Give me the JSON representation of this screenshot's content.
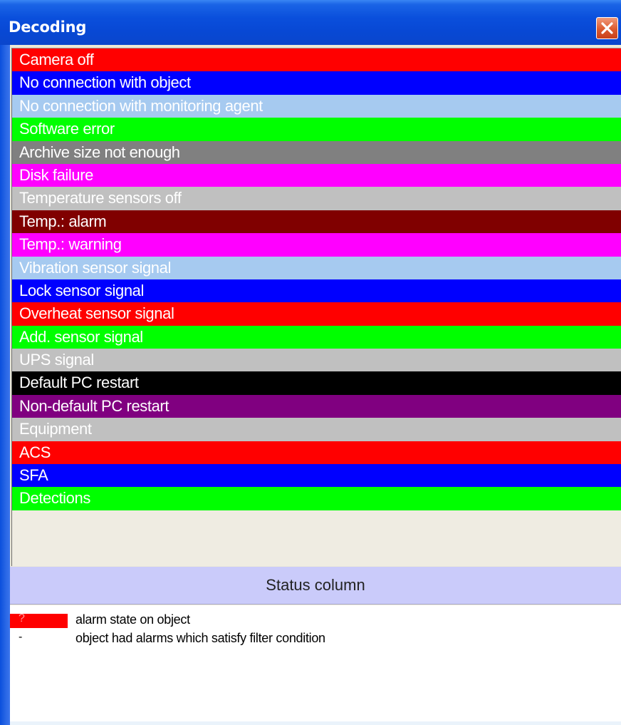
{
  "window": {
    "title": "Decoding"
  },
  "rows": [
    {
      "label": "Camera off",
      "bg": "#ff0000",
      "fg": "#ffffff"
    },
    {
      "label": "No connection with object",
      "bg": "#0000ff",
      "fg": "#ffffff"
    },
    {
      "label": "No connection with monitoring agent",
      "bg": "#a6caf0",
      "fg": "#ffffff"
    },
    {
      "label": "Software error",
      "bg": "#00ff00",
      "fg": "#ffffff"
    },
    {
      "label": "Archive size not enough",
      "bg": "#808080",
      "fg": "#ffffff"
    },
    {
      "label": "Disk failure",
      "bg": "#ff00ff",
      "fg": "#ffffff"
    },
    {
      "label": "Temperature sensors off",
      "bg": "#c0c0c0",
      "fg": "#ffffff"
    },
    {
      "label": "Temp.: alarm",
      "bg": "#800000",
      "fg": "#ffffff"
    },
    {
      "label": "Temp.: warning",
      "bg": "#ff00ff",
      "fg": "#ffffff"
    },
    {
      "label": "Vibration sensor signal",
      "bg": "#a6caf0",
      "fg": "#ffffff"
    },
    {
      "label": "Lock sensor signal",
      "bg": "#0000ff",
      "fg": "#ffffff"
    },
    {
      "label": "Overheat sensor signal",
      "bg": "#ff0000",
      "fg": "#ffffff"
    },
    {
      "label": "Add. sensor signal",
      "bg": "#00ff00",
      "fg": "#ffffff"
    },
    {
      "label": "UPS signal",
      "bg": "#c0c0c0",
      "fg": "#ffffff"
    },
    {
      "label": "Default PC restart",
      "bg": "#000000",
      "fg": "#ffffff"
    },
    {
      "label": "Non-default PC restart",
      "bg": "#800080",
      "fg": "#ffffff"
    },
    {
      "label": "Equipment",
      "bg": "#c0c0c0",
      "fg": "#ffffff"
    },
    {
      "label": "ACS",
      "bg": "#ff0000",
      "fg": "#ffffff"
    },
    {
      "label": "SFA",
      "bg": "#0000ff",
      "fg": "#ffffff"
    },
    {
      "label": "Detections",
      "bg": "#00ff00",
      "fg": "#ffffff"
    }
  ],
  "status": {
    "header": "Status column",
    "legend": [
      {
        "symbol": "?",
        "swatch": "#ff0000",
        "text": "alarm state on object"
      },
      {
        "symbol": "-",
        "swatch": "",
        "text": "object had alarms which satisfy filter condition"
      }
    ]
  }
}
